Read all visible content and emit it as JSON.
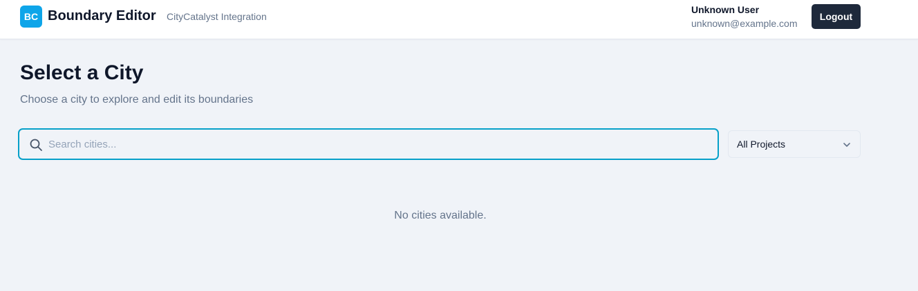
{
  "header": {
    "logo_text": "BC",
    "app_title": "Boundary Editor",
    "app_subtitle": "CityCatalyst Integration",
    "user_name": "Unknown User",
    "user_email": "unknown@example.com",
    "logout_label": "Logout"
  },
  "main": {
    "title": "Select a City",
    "description": "Choose a city to explore and edit its boundaries",
    "search": {
      "placeholder": "Search cities...",
      "value": "",
      "icon": "search-icon"
    },
    "project_filter": {
      "selected": "All Projects",
      "icon": "chevron-down-icon"
    },
    "empty_message": "No cities available."
  },
  "colors": {
    "accent": "#0ea5e9",
    "focus_border": "#06a0c9",
    "dark_button": "#1e293b",
    "background": "#f0f3f8"
  }
}
